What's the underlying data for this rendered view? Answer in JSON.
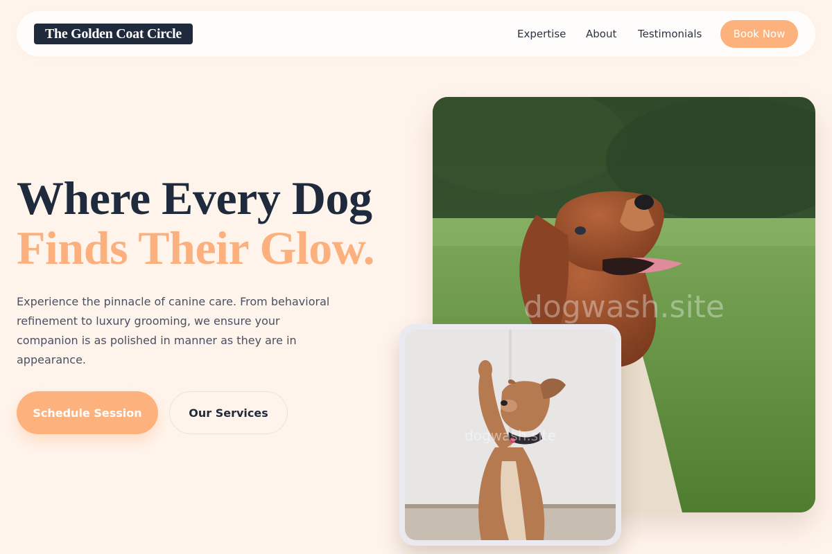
{
  "header": {
    "logo_text": "The Golden Coat Circle",
    "nav": [
      {
        "label": "Expertise"
      },
      {
        "label": "About"
      },
      {
        "label": "Testimonials"
      }
    ],
    "cta_label": "Book Now"
  },
  "hero": {
    "title_line1": "Where Every Dog",
    "title_line2": "Finds Their Glow.",
    "lead": "Experience the pinnacle of canine care. From behavioral refinement to luxury grooming, we ensure your companion is as polished in manner as they are in appearance.",
    "primary_button": "Schedule Session",
    "secondary_button": "Our Services"
  },
  "images": {
    "main_photo_watermark": "dogwash.site",
    "small_photo_watermark": "dogwash.site"
  },
  "colors": {
    "background": "#fff4ec",
    "accent": "#fdb27e",
    "navy": "#1f2a3d"
  }
}
